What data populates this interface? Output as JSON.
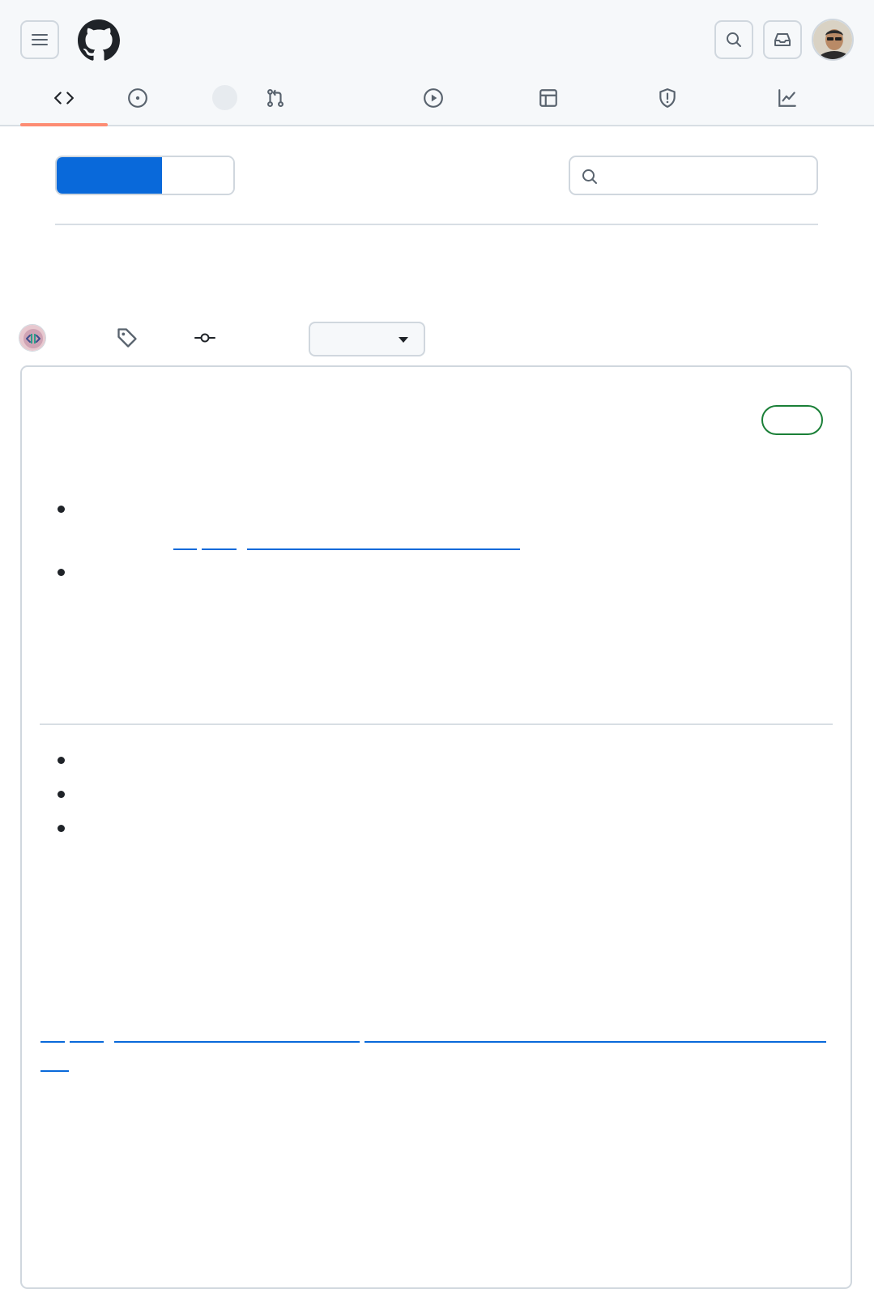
{
  "header": {
    "menu_icon": "hamburger-icon",
    "logo_icon": "github-octocat-icon",
    "search_icon": "search-icon",
    "inbox_icon": "inbox-icon",
    "avatar_alt": "user-avatar"
  },
  "nav_tabs": [
    {
      "icon": "code-icon",
      "selected": true
    },
    {
      "icon": "issue-opened-icon",
      "selected": false
    },
    {
      "icon": "git-pull-request-icon",
      "selected": false
    },
    {
      "icon": "play-icon",
      "selected": false
    },
    {
      "icon": "table-icon",
      "selected": false
    },
    {
      "icon": "shield-icon",
      "selected": false
    },
    {
      "icon": "graph-icon",
      "selected": false
    }
  ],
  "colors": {
    "accent": "#0969da",
    "selected_underline": "#fd8c73",
    "latest_badge": "#1a7f37",
    "border": "#d0d7de",
    "header_bg": "#f6f8fa"
  },
  "search": {
    "placeholder": ""
  },
  "release": {
    "author_avatar": "release-author-avatar",
    "tag_icon": "tag-icon",
    "commit_icon": "git-commit-icon",
    "compare_caret": "triangle-down-icon"
  }
}
